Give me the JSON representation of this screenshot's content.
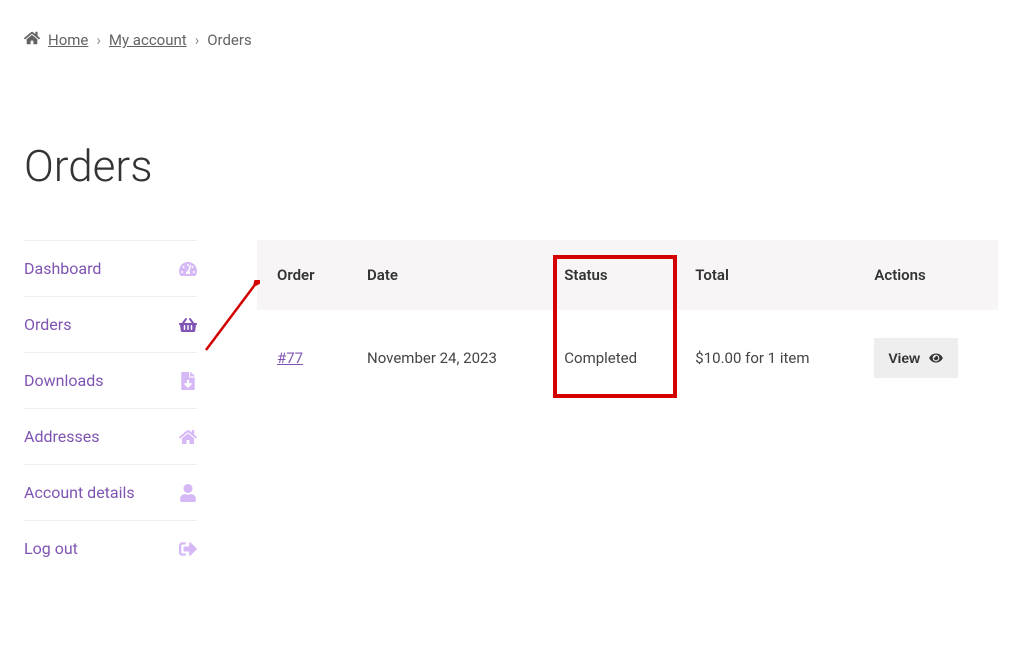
{
  "breadcrumb": {
    "home": "Home",
    "account": "My account",
    "current": "Orders"
  },
  "page_title": "Orders",
  "sidebar": {
    "items": [
      {
        "label": "Dashboard",
        "icon": "dashboard-icon",
        "active": false
      },
      {
        "label": "Orders",
        "icon": "basket-icon",
        "active": true
      },
      {
        "label": "Downloads",
        "icon": "file-icon",
        "active": false
      },
      {
        "label": "Addresses",
        "icon": "home-icon",
        "active": false
      },
      {
        "label": "Account details",
        "icon": "user-icon",
        "active": false
      },
      {
        "label": "Log out",
        "icon": "logout-icon",
        "active": false
      }
    ]
  },
  "table": {
    "headers": {
      "order": "Order",
      "date": "Date",
      "status": "Status",
      "total": "Total",
      "actions": "Actions"
    },
    "rows": [
      {
        "order": "#77",
        "date": "November 24, 2023",
        "status": "Completed",
        "total": "$10.00 for 1 item",
        "action_label": "View"
      }
    ]
  },
  "annotations": {
    "status_column_highlight": true,
    "arrow_pointing_to_orders_nav": true
  }
}
